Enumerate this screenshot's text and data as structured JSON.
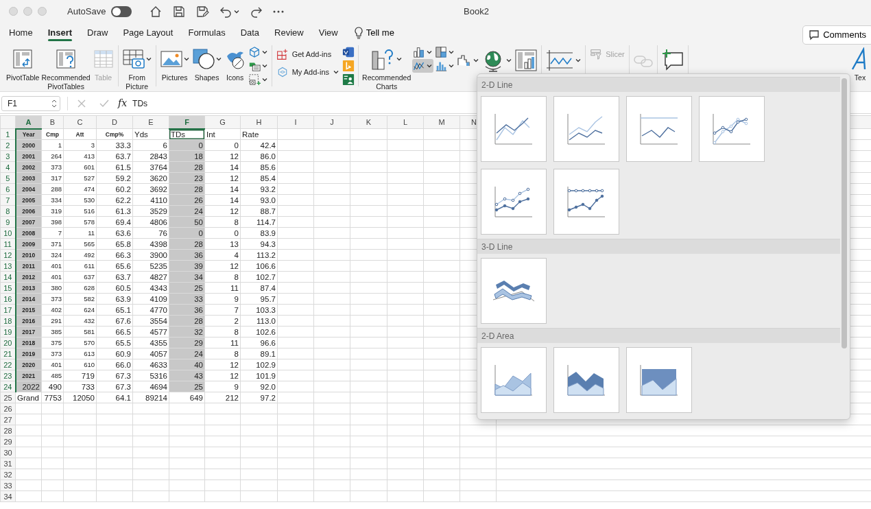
{
  "window": {
    "title": "Book2",
    "autosave": {
      "label": "AutoSave",
      "on": false
    }
  },
  "quick_access": [
    {
      "menu": false
    },
    {
      "menu": false
    },
    {
      "menu": false
    },
    {
      "menu": true
    },
    {
      "menu": false
    },
    {
      "menu": false
    }
  ],
  "tabs": [
    {
      "label": "Home",
      "selected": false
    },
    {
      "label": "Insert",
      "selected": true
    },
    {
      "label": "Draw",
      "selected": false
    },
    {
      "label": "Page Layout",
      "selected": false
    },
    {
      "label": "Formulas",
      "selected": false
    },
    {
      "label": "Data",
      "selected": false
    },
    {
      "label": "Review",
      "selected": false
    },
    {
      "label": "View",
      "selected": false
    }
  ],
  "tell_me": {
    "label": "Tell me"
  },
  "comments_button": {
    "label": "Comments"
  },
  "ribbon": {
    "groups": [
      {
        "items": [
          {
            "kind": "large",
            "label": "PivotTable",
            "menu": false,
            "disabled": false
          },
          {
            "kind": "large",
            "label": "Recommended PivotTables",
            "menu": false,
            "disabled": false
          },
          {
            "kind": "large",
            "label": "Table",
            "menu": false,
            "disabled": true
          }
        ]
      },
      {
        "items": [
          {
            "kind": "large",
            "label": "From Picture",
            "menu": true,
            "disabled": false
          }
        ]
      },
      {
        "items": [
          {
            "kind": "large",
            "label": "Pictures",
            "menu": true,
            "disabled": false
          },
          {
            "kind": "large",
            "label": "Shapes",
            "menu": true,
            "disabled": false
          },
          {
            "kind": "large",
            "label": "Icons",
            "menu": false,
            "disabled": false
          },
          {
            "kind": "stack",
            "items": [
              {
                "kind": "icon",
                "menu": true,
                "selected": false,
                "disabled": false
              },
              {
                "kind": "icon",
                "menu": true,
                "selected": false,
                "disabled": false
              },
              {
                "kind": "icon",
                "menu": true,
                "selected": false,
                "disabled": false
              }
            ]
          }
        ]
      },
      {
        "items": [
          {
            "kind": "stack",
            "items": [
              {
                "kind": "small",
                "label": "Get Add-ins",
                "menu": false,
                "disabled": false
              },
              {
                "kind": "small",
                "label": "My Add-ins",
                "menu": true,
                "disabled": false
              }
            ]
          },
          {
            "kind": "stack",
            "items": [
              {
                "kind": "icon",
                "menu": false,
                "selected": false,
                "disabled": false
              },
              {
                "kind": "icon",
                "menu": false,
                "selected": false,
                "disabled": false
              },
              {
                "kind": "icon",
                "menu": false,
                "selected": false,
                "disabled": false
              }
            ]
          }
        ]
      },
      {
        "items": [
          {
            "kind": "large",
            "label": "Recommended Charts",
            "menu": true,
            "disabled": false
          },
          {
            "kind": "stack",
            "items": [
              {
                "kind": "icon",
                "menu": true,
                "selected": false,
                "disabled": false
              },
              {
                "kind": "icon",
                "menu": true,
                "selected": true,
                "disabled": false
              }
            ]
          },
          {
            "kind": "stack",
            "items": [
              {
                "kind": "icon",
                "menu": true,
                "selected": false,
                "disabled": false
              },
              {
                "kind": "icon",
                "menu": true,
                "selected": false,
                "disabled": false
              }
            ]
          },
          {
            "kind": "icon",
            "menu": true,
            "selected": false,
            "disabled": false
          },
          {
            "kind": "icon",
            "menu": true,
            "selected": false,
            "disabled": false
          },
          {
            "kind": "icon",
            "menu": false,
            "selected": false,
            "disabled": false
          }
        ]
      },
      {
        "items": [
          {
            "kind": "icon",
            "menu": true,
            "selected": false,
            "disabled": false
          }
        ]
      },
      {
        "items": [
          {
            "kind": "small",
            "label": "Slicer",
            "menu": false,
            "disabled": true
          }
        ]
      },
      {
        "items": [
          {
            "kind": "icon",
            "menu": false,
            "selected": false,
            "disabled": true
          }
        ]
      },
      {
        "items": [
          {
            "kind": "icon",
            "menu": false,
            "selected": false,
            "disabled": false
          }
        ]
      },
      {
        "items": [
          {
            "kind": "large",
            "label": "Tex",
            "menu": false,
            "disabled": false
          }
        ]
      }
    ]
  },
  "formula_bar": {
    "name_box": "F1",
    "fx": "fx",
    "value": "TDs"
  },
  "sheet": {
    "columns": [
      {
        "letter": "A",
        "selected": true
      },
      {
        "letter": "B",
        "selected": false
      },
      {
        "letter": "C",
        "selected": false
      },
      {
        "letter": "D",
        "selected": false
      },
      {
        "letter": "E",
        "selected": false
      },
      {
        "letter": "F",
        "selected": true
      },
      {
        "letter": "G",
        "selected": false
      },
      {
        "letter": "H",
        "selected": false
      },
      {
        "letter": "I",
        "selected": false
      },
      {
        "letter": "J",
        "selected": false
      },
      {
        "letter": "K",
        "selected": false
      },
      {
        "letter": "L",
        "selected": false
      },
      {
        "letter": "M",
        "selected": false
      },
      {
        "letter": "N",
        "selected": false
      }
    ],
    "rows": [
      {
        "number": "1",
        "selected": true,
        "kind": "header",
        "cells": [
          {
            "text": "Year",
            "active": false
          },
          {
            "text": "Cmp",
            "active": false
          },
          {
            "text": "Att",
            "active": false
          },
          {
            "text": "Cmp%",
            "active": false
          },
          {
            "text": "Yds",
            "active": false
          },
          {
            "text": "TDs",
            "active": true
          },
          {
            "text": "Int",
            "active": false
          },
          {
            "text": "Rate",
            "active": false
          }
        ]
      },
      {
        "number": "2",
        "selected": true,
        "kind": "compact",
        "cells": [
          "2000",
          "1",
          "3",
          "33.3",
          "6",
          "0",
          "0",
          "42.4"
        ]
      },
      {
        "number": "3",
        "selected": true,
        "kind": "compact",
        "cells": [
          "2001",
          "264",
          "413",
          "63.7",
          "2843",
          "18",
          "12",
          "86.0"
        ]
      },
      {
        "number": "4",
        "selected": true,
        "kind": "compact",
        "cells": [
          "2002",
          "373",
          "601",
          "61.5",
          "3764",
          "28",
          "14",
          "85.6"
        ]
      },
      {
        "number": "5",
        "selected": true,
        "kind": "compact",
        "cells": [
          "2003",
          "317",
          "527",
          "59.2",
          "3620",
          "23",
          "12",
          "85.4"
        ]
      },
      {
        "number": "6",
        "selected": true,
        "kind": "compact",
        "cells": [
          "2004",
          "288",
          "474",
          "60.2",
          "3692",
          "28",
          "14",
          "93.2"
        ]
      },
      {
        "number": "7",
        "selected": true,
        "kind": "compact",
        "cells": [
          "2005",
          "334",
          "530",
          "62.2",
          "4110",
          "26",
          "14",
          "93.0"
        ]
      },
      {
        "number": "8",
        "selected": true,
        "kind": "compact",
        "cells": [
          "2006",
          "319",
          "516",
          "61.3",
          "3529",
          "24",
          "12",
          "88.7"
        ]
      },
      {
        "number": "9",
        "selected": true,
        "kind": "compact",
        "cells": [
          "2007",
          "398",
          "578",
          "69.4",
          "4806",
          "50",
          "8",
          "114.7"
        ]
      },
      {
        "number": "10",
        "selected": true,
        "kind": "compact",
        "cells": [
          "2008",
          "7",
          "11",
          "63.6",
          "76",
          "0",
          "0",
          "83.9"
        ]
      },
      {
        "number": "11",
        "selected": true,
        "kind": "compact",
        "cells": [
          "2009",
          "371",
          "565",
          "65.8",
          "4398",
          "28",
          "13",
          "94.3"
        ]
      },
      {
        "number": "12",
        "selected": true,
        "kind": "compact",
        "cells": [
          "2010",
          "324",
          "492",
          "66.3",
          "3900",
          "36",
          "4",
          "113.2"
        ]
      },
      {
        "number": "13",
        "selected": true,
        "kind": "compact",
        "cells": [
          "2011",
          "401",
          "611",
          "65.6",
          "5235",
          "39",
          "12",
          "106.6"
        ]
      },
      {
        "number": "14",
        "selected": true,
        "kind": "compact",
        "cells": [
          "2012",
          "401",
          "637",
          "63.7",
          "4827",
          "34",
          "8",
          "102.7"
        ]
      },
      {
        "number": "15",
        "selected": true,
        "kind": "compact",
        "cells": [
          "2013",
          "380",
          "628",
          "60.5",
          "4343",
          "25",
          "11",
          "87.4"
        ]
      },
      {
        "number": "16",
        "selected": true,
        "kind": "compact",
        "cells": [
          "2014",
          "373",
          "582",
          "63.9",
          "4109",
          "33",
          "9",
          "95.7"
        ]
      },
      {
        "number": "17",
        "selected": true,
        "kind": "compact",
        "cells": [
          "2015",
          "402",
          "624",
          "65.1",
          "4770",
          "36",
          "7",
          "103.3"
        ]
      },
      {
        "number": "18",
        "selected": true,
        "kind": "compact",
        "cells": [
          "2016",
          "291",
          "432",
          "67.6",
          "3554",
          "28",
          "2",
          "113.0"
        ]
      },
      {
        "number": "19",
        "selected": true,
        "kind": "compact",
        "cells": [
          "2017",
          "385",
          "581",
          "66.5",
          "4577",
          "32",
          "8",
          "102.6"
        ]
      },
      {
        "number": "20",
        "selected": true,
        "kind": "compact",
        "cells": [
          "2018",
          "375",
          "570",
          "65.5",
          "4355",
          "29",
          "11",
          "96.6"
        ]
      },
      {
        "number": "21",
        "selected": true,
        "kind": "compact",
        "cells": [
          "2019",
          "373",
          "613",
          "60.9",
          "4057",
          "24",
          "8",
          "89.1"
        ]
      },
      {
        "number": "22",
        "selected": true,
        "kind": "compact",
        "cells": [
          "2020",
          "401",
          "610",
          "66.0",
          "4633",
          "40",
          "12",
          "102.9"
        ]
      },
      {
        "number": "23",
        "selected": true,
        "kind": "compact-a-b",
        "cells": [
          "2021",
          "485",
          "719",
          "67.3",
          "5316",
          "43",
          "12",
          "101.9"
        ]
      },
      {
        "number": "24",
        "selected": true,
        "kind": "plain",
        "cells": [
          "2022",
          "490",
          "733",
          "67.3",
          "4694",
          "25",
          "9",
          "92.0"
        ]
      },
      {
        "number": "25",
        "selected": false,
        "kind": "total",
        "cells": [
          "Grand",
          "7753",
          "12050",
          "64.1",
          "89214",
          "649",
          "212",
          "97.2"
        ]
      },
      {
        "number": "26",
        "selected": false,
        "kind": "empty"
      },
      {
        "number": "27",
        "selected": false,
        "kind": "empty"
      },
      {
        "number": "28",
        "selected": false,
        "kind": "empty"
      },
      {
        "number": "29",
        "selected": false,
        "kind": "empty"
      },
      {
        "number": "30",
        "selected": false,
        "kind": "empty"
      },
      {
        "number": "31",
        "selected": false,
        "kind": "empty"
      },
      {
        "number": "32",
        "selected": false,
        "kind": "empty"
      },
      {
        "number": "33",
        "selected": false,
        "kind": "empty"
      },
      {
        "number": "34",
        "selected": false,
        "kind": "empty"
      }
    ]
  },
  "chart_menu": {
    "sections": [
      {
        "title": "2-D Line",
        "items": [
          {
            "kind": "line"
          },
          {
            "kind": "stacked-line"
          },
          {
            "kind": "percent-line"
          },
          {
            "kind": "line-markers"
          },
          {
            "kind": "stacked-line-markers"
          },
          {
            "kind": "percent-line-markers"
          }
        ]
      },
      {
        "title": "3-D Line",
        "items": [
          {
            "kind": "line3d"
          }
        ]
      },
      {
        "title": "2-D Area",
        "items": [
          {
            "kind": "area"
          },
          {
            "kind": "stacked-area"
          },
          {
            "kind": "percent-area"
          }
        ]
      }
    ]
  }
}
